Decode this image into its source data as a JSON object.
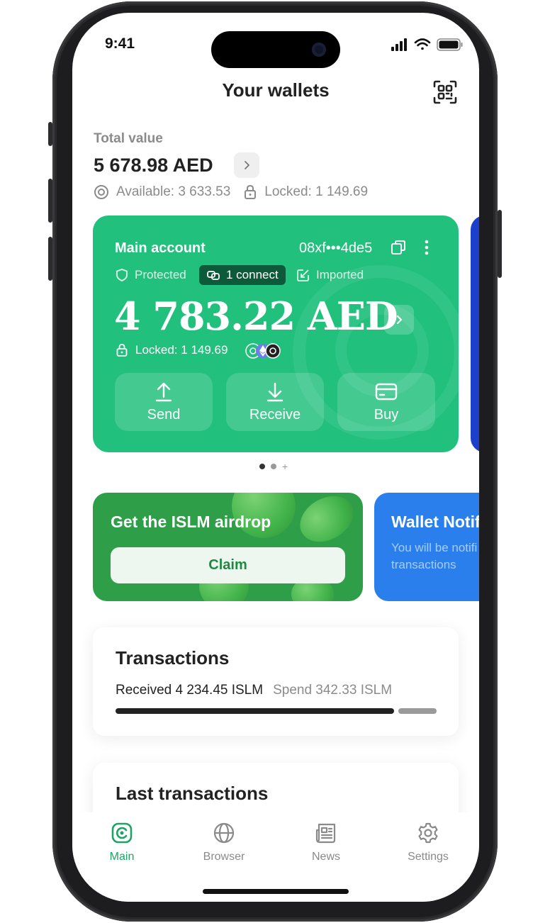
{
  "status_bar": {
    "time": "9:41"
  },
  "header": {
    "title": "Your wallets"
  },
  "summary": {
    "total_label": "Total value",
    "total_value": "5 678.98 AED",
    "available": "Available: 3 633.53",
    "locked": "Locked: 1 149.69"
  },
  "wallet_card": {
    "name": "Main account",
    "address": "08xf•••4de5",
    "tags": {
      "protected": "Protected",
      "connect": "1 connect",
      "imported": "Imported"
    },
    "balance": "4 783.22 AED",
    "locked": "Locked: 1 149.69",
    "actions": {
      "send": "Send",
      "receive": "Receive",
      "buy": "Buy"
    },
    "color": "#21c07d",
    "pager": {
      "pages": 2,
      "active_page": 1
    }
  },
  "promos": {
    "airdrop": {
      "title": "Get the ISLM airdrop",
      "button": "Claim"
    },
    "notifications": {
      "title": "Wallet Notif",
      "text_line1": "You will be notifi",
      "text_line2": "transactions"
    }
  },
  "transactions": {
    "title": "Transactions",
    "received": "Received 4 234.45 ISLM",
    "spend": "Spend 342.33 ISLM",
    "received_amount": 4234.45,
    "spend_amount": 342.33
  },
  "last_transactions": {
    "title": "Last transactions"
  },
  "tabbar": {
    "items": [
      {
        "label": "Main",
        "icon": "main-logo-icon",
        "active": true
      },
      {
        "label": "Browser",
        "icon": "globe-icon",
        "active": false
      },
      {
        "label": "News",
        "icon": "newspaper-icon",
        "active": false
      },
      {
        "label": "Settings",
        "icon": "gear-icon",
        "active": false
      }
    ],
    "active_color": "#1fa365",
    "inactive_color": "#8a8a8a"
  }
}
